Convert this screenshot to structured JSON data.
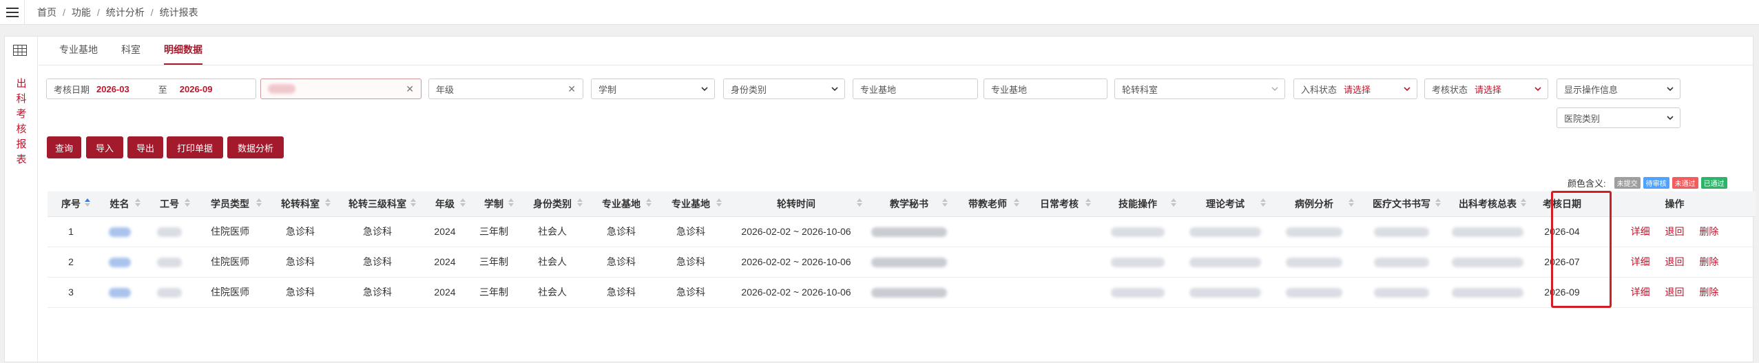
{
  "breadcrumb": [
    "首页",
    "功能",
    "统计分析",
    "统计报表"
  ],
  "breadcrumb_sep": "/",
  "side_title": [
    "出",
    "科",
    "考",
    "核",
    "报",
    "表"
  ],
  "tabs": [
    {
      "label": "专业基地",
      "active": false
    },
    {
      "label": "科室",
      "active": false
    },
    {
      "label": "明细数据",
      "active": true
    }
  ],
  "filters": {
    "date_label": "考核日期",
    "date_from": "2026-03",
    "date_to_word": "至",
    "date_to": "2026-09",
    "grade_placeholder": "年级",
    "schooling_placeholder": "学制",
    "identity_placeholder": "身份类别",
    "base1_placeholder": "专业基地",
    "base2_placeholder": "专业基地",
    "rotation_dept_placeholder": "轮转科室",
    "entry_status_label": "入科状态",
    "entry_status_value": "请选择",
    "exam_status_label": "考核状态",
    "exam_status_value": "请选择",
    "show_ops_placeholder": "显示操作信息",
    "hospital_type_placeholder": "医院类别"
  },
  "buttons": {
    "query": "查询",
    "import": "导入",
    "export": "导出",
    "print": "打印单据",
    "analysis": "数据分析"
  },
  "legend": {
    "label": "颜色含义:",
    "items": [
      {
        "text": "未提交",
        "color": "#9e9e9e"
      },
      {
        "text": "待审核",
        "color": "#4da3ff"
      },
      {
        "text": "未通过",
        "color": "#f25c5c"
      },
      {
        "text": "已通过",
        "color": "#2fb36b"
      }
    ]
  },
  "table": {
    "headers": [
      "序号",
      "姓名",
      "工号",
      "学员类型",
      "轮转科室",
      "轮转三级科室",
      "年级",
      "学制",
      "身份类别",
      "专业基地",
      "专业基地",
      "轮转时间",
      "教学秘书",
      "带教老师",
      "日常考核",
      "技能操作",
      "理论考试",
      "病例分析",
      "医疗文书书写",
      "出科考核总表",
      "考核日期",
      "操作"
    ],
    "rows": [
      {
        "no": "1",
        "type": "住院医师",
        "dept": "急诊科",
        "dept3": "急诊科",
        "grade": "2024",
        "schooling": "三年制",
        "identity": "社会人",
        "base1": "急诊科",
        "base2": "急诊科",
        "period": "2026-02-02 ~ 2026-10-06",
        "exam_date": "2026-04"
      },
      {
        "no": "2",
        "type": "住院医师",
        "dept": "急诊科",
        "dept3": "急诊科",
        "grade": "2024",
        "schooling": "三年制",
        "identity": "社会人",
        "base1": "急诊科",
        "base2": "急诊科",
        "period": "2026-02-02 ~ 2026-10-06",
        "exam_date": "2026-07"
      },
      {
        "no": "3",
        "type": "住院医师",
        "dept": "急诊科",
        "dept3": "急诊科",
        "grade": "2024",
        "schooling": "三年制",
        "identity": "社会人",
        "base1": "急诊科",
        "base2": "急诊科",
        "period": "2026-02-02 ~ 2026-10-06",
        "exam_date": "2026-09"
      }
    ],
    "actions": [
      "详细",
      "退回",
      "删除"
    ]
  }
}
